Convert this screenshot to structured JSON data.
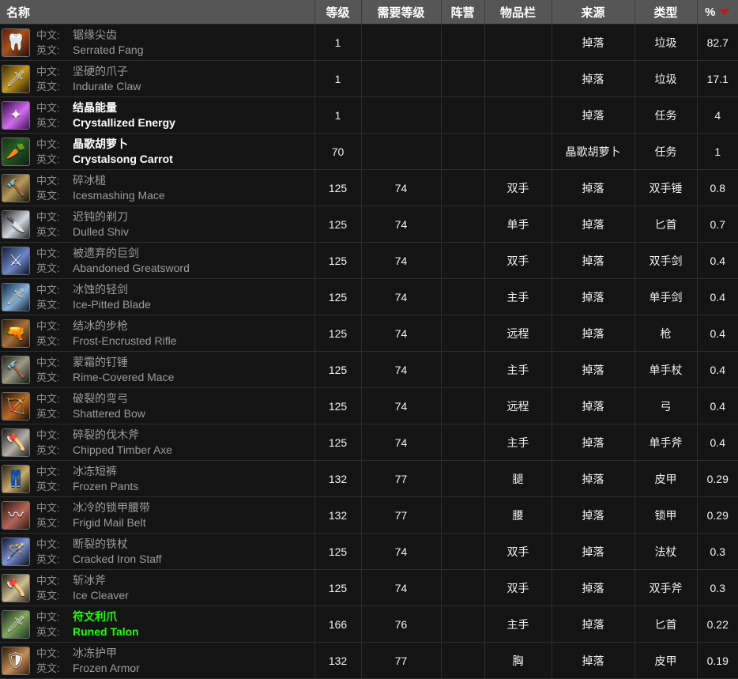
{
  "table": {
    "columns": [
      {
        "key": "name",
        "label": "名称"
      },
      {
        "key": "level",
        "label": "等级"
      },
      {
        "key": "reqlevel",
        "label": "需要等级"
      },
      {
        "key": "faction",
        "label": "阵营"
      },
      {
        "key": "slot",
        "label": "物品栏"
      },
      {
        "key": "source",
        "label": "来源"
      },
      {
        "key": "type",
        "label": "类型"
      },
      {
        "key": "pct",
        "label": "%"
      }
    ],
    "sort": {
      "column": "pct",
      "direction": "desc",
      "indicator_icon": "sort-descending-triangle-icon",
      "indicator_color": "#b41f1f"
    },
    "labels": {
      "cn": "中文:",
      "en": "英文:"
    },
    "quality_colors": {
      "poor": "#9d9d9d",
      "common": "#ffffff",
      "uncommon": "#1eff00"
    },
    "rows": [
      {
        "icon": "serrated-fang-icon",
        "icon_glyph": "🦷",
        "icon_bg": "linear-gradient(135deg,#5a1d08,#a8531c 45%,#2a0d04)",
        "quality": "poor",
        "name_cn": "锯缘尖齿",
        "name_en": "Serrated Fang",
        "level": "1",
        "reqlevel": "",
        "faction": "",
        "slot": "",
        "source": "掉落",
        "type": "垃圾",
        "pct": "82.7"
      },
      {
        "icon": "indurate-claw-icon",
        "icon_glyph": "🗡",
        "icon_bg": "linear-gradient(135deg,#3a2a06,#c49a22 50%,#201401)",
        "quality": "poor",
        "name_cn": "坚硬的爪子",
        "name_en": "Indurate Claw",
        "level": "1",
        "reqlevel": "",
        "faction": "",
        "slot": "",
        "source": "掉落",
        "type": "垃圾",
        "pct": "17.1"
      },
      {
        "icon": "crystallized-energy-icon",
        "icon_glyph": "✦",
        "icon_bg": "linear-gradient(135deg,#2a0b3a,#d36bf0 55%,#3d1152)",
        "quality": "common",
        "name_cn": "结晶能量",
        "name_en": "Crystallized Energy",
        "level": "1",
        "reqlevel": "",
        "faction": "",
        "slot": "",
        "source": "掉落",
        "type": "任务",
        "pct": "4"
      },
      {
        "icon": "crystalsong-carrot-icon",
        "icon_glyph": "🥕",
        "icon_bg": "linear-gradient(135deg,#123012,#2c5a24 40%,#0e2210)",
        "quality": "common",
        "name_cn": "晶歌胡萝卜",
        "name_en": "Crystalsong Carrot",
        "level": "70",
        "reqlevel": "",
        "faction": "",
        "slot": "",
        "source": "晶歌胡萝卜",
        "type": "任务",
        "pct": "1"
      },
      {
        "icon": "icesmashing-mace-icon",
        "icon_glyph": "🔨",
        "icon_bg": "linear-gradient(135deg,#2a2118,#b79b5a 50%,#17120b)",
        "quality": "poor",
        "name_cn": "碎冰槌",
        "name_en": "Icesmashing Mace",
        "level": "125",
        "reqlevel": "74",
        "faction": "",
        "slot": "双手",
        "source": "掉落",
        "type": "双手锤",
        "pct": "0.8"
      },
      {
        "icon": "dulled-shiv-icon",
        "icon_glyph": "🔪",
        "icon_bg": "linear-gradient(135deg,#1b1b1e,#d3d6dc 55%,#26262b)",
        "quality": "poor",
        "name_cn": "迟钝的剃刀",
        "name_en": "Dulled Shiv",
        "level": "125",
        "reqlevel": "74",
        "faction": "",
        "slot": "单手",
        "source": "掉落",
        "type": "匕首",
        "pct": "0.7"
      },
      {
        "icon": "abandoned-greatsword-icon",
        "icon_glyph": "⚔",
        "icon_bg": "linear-gradient(135deg,#101c3a,#6f86c8 55%,#0c1226)",
        "quality": "poor",
        "name_cn": "被遗弃的巨剑",
        "name_en": "Abandoned Greatsword",
        "level": "125",
        "reqlevel": "74",
        "faction": "",
        "slot": "双手",
        "source": "掉落",
        "type": "双手剑",
        "pct": "0.4"
      },
      {
        "icon": "ice-pitted-blade-icon",
        "icon_glyph": "🗡",
        "icon_bg": "linear-gradient(135deg,#0f2640,#8ab6dd 55%,#0b1a2c)",
        "quality": "poor",
        "name_cn": "冰蚀的轻剑",
        "name_en": "Ice-Pitted Blade",
        "level": "125",
        "reqlevel": "74",
        "faction": "",
        "slot": "主手",
        "source": "掉落",
        "type": "单手剑",
        "pct": "0.4"
      },
      {
        "icon": "frost-encrusted-rifle-icon",
        "icon_glyph": "🔫",
        "icon_bg": "linear-gradient(135deg,#241608,#a8703a 50%,#160d05)",
        "quality": "poor",
        "name_cn": "结冰的步枪",
        "name_en": "Frost-Encrusted Rifle",
        "level": "125",
        "reqlevel": "74",
        "faction": "",
        "slot": "远程",
        "source": "掉落",
        "type": "枪",
        "pct": "0.4"
      },
      {
        "icon": "rime-covered-mace-icon",
        "icon_glyph": "🔨",
        "icon_bg": "linear-gradient(135deg,#222018,#9a9a86 50%,#15140f)",
        "quality": "poor",
        "name_cn": "蒙霜的钉锤",
        "name_en": "Rime-Covered Mace",
        "level": "125",
        "reqlevel": "74",
        "faction": "",
        "slot": "主手",
        "source": "掉落",
        "type": "单手杖",
        "pct": "0.4"
      },
      {
        "icon": "shattered-bow-icon",
        "icon_glyph": "🏹",
        "icon_bg": "linear-gradient(135deg,#1d1008,#c06a22 55%,#150a04)",
        "quality": "poor",
        "name_cn": "破裂的弯弓",
        "name_en": "Shattered Bow",
        "level": "125",
        "reqlevel": "74",
        "faction": "",
        "slot": "远程",
        "source": "掉落",
        "type": "弓",
        "pct": "0.4"
      },
      {
        "icon": "chipped-timber-axe-icon",
        "icon_glyph": "🪓",
        "icon_bg": "linear-gradient(135deg,#1d1912,#b4b0a6 55%,#23201a)",
        "quality": "poor",
        "name_cn": "碎裂的伐木斧",
        "name_en": "Chipped Timber Axe",
        "level": "125",
        "reqlevel": "74",
        "faction": "",
        "slot": "主手",
        "source": "掉落",
        "type": "单手斧",
        "pct": "0.4"
      },
      {
        "icon": "frozen-pants-icon",
        "icon_glyph": "👖",
        "icon_bg": "linear-gradient(135deg,#241c0e,#c9ad6c 55%,#1a1409)",
        "quality": "poor",
        "name_cn": "冰冻短裤",
        "name_en": "Frozen Pants",
        "level": "132",
        "reqlevel": "77",
        "faction": "",
        "slot": "腿",
        "source": "掉落",
        "type": "皮甲",
        "pct": "0.29"
      },
      {
        "icon": "frigid-mail-belt-icon",
        "icon_glyph": "〰",
        "icon_bg": "linear-gradient(135deg,#241410,#b4665a 55%,#2d1a14)",
        "quality": "poor",
        "name_cn": "冰冷的锁甲腰带",
        "name_en": "Frigid Mail Belt",
        "level": "132",
        "reqlevel": "77",
        "faction": "",
        "slot": "腰",
        "source": "掉落",
        "type": "锁甲",
        "pct": "0.29"
      },
      {
        "icon": "cracked-iron-staff-icon",
        "icon_glyph": "🪄",
        "icon_bg": "linear-gradient(135deg,#0d1430,#7f93d8 50%,#0a0f22)",
        "quality": "poor",
        "name_cn": "断裂的铁杖",
        "name_en": "Cracked Iron Staff",
        "level": "125",
        "reqlevel": "74",
        "faction": "",
        "slot": "双手",
        "source": "掉落",
        "type": "法杖",
        "pct": "0.3"
      },
      {
        "icon": "ice-cleaver-icon",
        "icon_glyph": "🪓",
        "icon_bg": "linear-gradient(135deg,#241f14,#cdbf93 55%,#2e281a)",
        "quality": "poor",
        "name_cn": "斩冰斧",
        "name_en": "Ice Cleaver",
        "level": "125",
        "reqlevel": "74",
        "faction": "",
        "slot": "双手",
        "source": "掉落",
        "type": "双手斧",
        "pct": "0.3"
      },
      {
        "icon": "runed-talon-icon",
        "icon_glyph": "🗡",
        "icon_bg": "linear-gradient(135deg,#16241a,#7fa85c 50%,#1c3322)",
        "quality": "uncommon",
        "name_cn": "符文利爪",
        "name_en": "Runed Talon",
        "level": "166",
        "reqlevel": "76",
        "faction": "",
        "slot": "主手",
        "source": "掉落",
        "type": "匕首",
        "pct": "0.22"
      },
      {
        "icon": "frozen-armor-icon",
        "icon_glyph": "🛡",
        "icon_bg": "linear-gradient(135deg,#2c1a0c,#c58d55 55%,#35200f)",
        "quality": "poor",
        "name_cn": "冰冻护甲",
        "name_en": "Frozen Armor",
        "level": "132",
        "reqlevel": "77",
        "faction": "",
        "slot": "胸",
        "source": "掉落",
        "type": "皮甲",
        "pct": "0.19"
      }
    ]
  }
}
